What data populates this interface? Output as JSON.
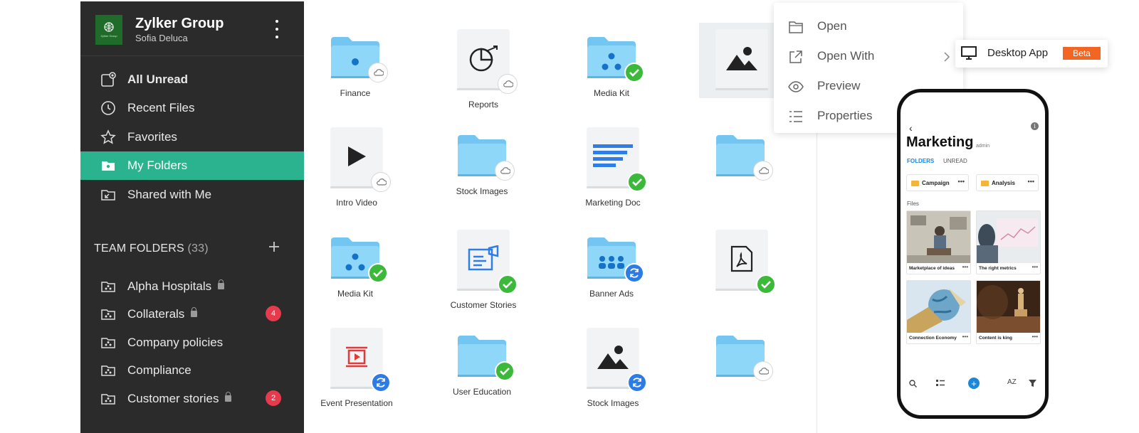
{
  "org": {
    "name": "Zylker Group",
    "user": "Sofia Deluca",
    "logo_text": "Zylker Group"
  },
  "nav": {
    "all_unread": "All Unread",
    "recent": "Recent Files",
    "favorites": "Favorites",
    "my_folders": "My Folders",
    "shared": "Shared with Me"
  },
  "team": {
    "title": "TEAM FOLDERS",
    "count": "(33)",
    "items": [
      {
        "label": "Alpha Hospitals",
        "locked": true,
        "badge": ""
      },
      {
        "label": "Collaterals",
        "locked": true,
        "badge": "4"
      },
      {
        "label": "Company policies",
        "locked": false,
        "badge": ""
      },
      {
        "label": "Compliance",
        "locked": false,
        "badge": ""
      },
      {
        "label": "Customer stories",
        "locked": true,
        "badge": "2"
      }
    ]
  },
  "files": [
    {
      "label": "Finance",
      "kind": "folder",
      "status": "cloud"
    },
    {
      "label": "Reports",
      "kind": "doc",
      "status": "cloud"
    },
    {
      "label": "Media Kit",
      "kind": "folder",
      "status": "check"
    },
    {
      "label": "",
      "kind": "image",
      "status": ""
    },
    {
      "label": "Intro Video",
      "kind": "video",
      "status": "cloud"
    },
    {
      "label": "Stock Images",
      "kind": "folder",
      "status": "cloud"
    },
    {
      "label": "Marketing Doc",
      "kind": "doc",
      "status": "check"
    },
    {
      "label": "",
      "kind": "folder",
      "status": "cloud"
    },
    {
      "label": "Media Kit",
      "kind": "folder",
      "status": "check"
    },
    {
      "label": "Customer Stories",
      "kind": "doc",
      "status": "check"
    },
    {
      "label": "Banner Ads",
      "kind": "folder",
      "status": "sync"
    },
    {
      "label": "",
      "kind": "pdf",
      "status": "check"
    },
    {
      "label": "Event Presentation",
      "kind": "doc",
      "status": "sync"
    },
    {
      "label": "User Education",
      "kind": "folder",
      "status": "check"
    },
    {
      "label": "Stock Images",
      "kind": "image",
      "status": "sync"
    },
    {
      "label": "",
      "kind": "folder",
      "status": "cloud"
    }
  ],
  "menu": {
    "open": "Open",
    "open_with": "Open With",
    "preview": "Preview",
    "properties": "Properties",
    "desktop_app": "Desktop App",
    "beta": "Beta"
  },
  "phone": {
    "title": "Marketing",
    "role": "admin",
    "tab_folders": "FOLDERS",
    "tab_unread": "UNREAD",
    "chips": [
      "Campaign",
      "Analysis"
    ],
    "files_label": "Files",
    "cards": [
      "Marketplace of ideas",
      "The right metrics",
      "Connection Economy",
      "Content is king"
    ],
    "more": "•••",
    "back": "‹",
    "info": "i",
    "add": "+",
    "sort": "AZ"
  },
  "colors": {
    "accent": "#2bb28e",
    "sidebar": "#2b2b2b",
    "folder": "#7ccdf5",
    "check": "#3cb83a",
    "sync": "#2d7be5",
    "badge": "#e53b4c",
    "beta": "#f26522"
  }
}
